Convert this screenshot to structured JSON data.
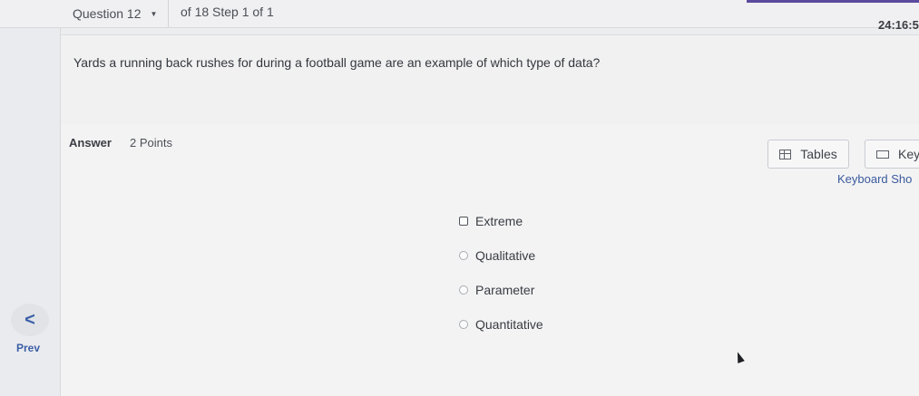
{
  "header": {
    "question_dropdown": "Question 12",
    "progress": "of 18 Step 1 of 1",
    "timer": "24:16:5"
  },
  "nav": {
    "prev_glyph": "<",
    "prev_label": "Prev"
  },
  "question": {
    "text": "Yards a running back rushes for during a football game are an example of which type of data?"
  },
  "answer": {
    "label": "Answer",
    "points": "2 Points",
    "tables_label": "Tables",
    "keypad_label": "Key",
    "keyboard_shortcuts": "Keyboard Sho",
    "options": [
      {
        "label": "Extreme"
      },
      {
        "label": "Qualitative"
      },
      {
        "label": "Parameter"
      },
      {
        "label": "Quantitative"
      }
    ]
  },
  "icons": {
    "dropdown_caret": "caret-down-icon",
    "tables": "table-icon",
    "keypad": "keyboard-icon"
  },
  "colors": {
    "accent": "#5b4a9e",
    "link": "#3b5fa8"
  }
}
